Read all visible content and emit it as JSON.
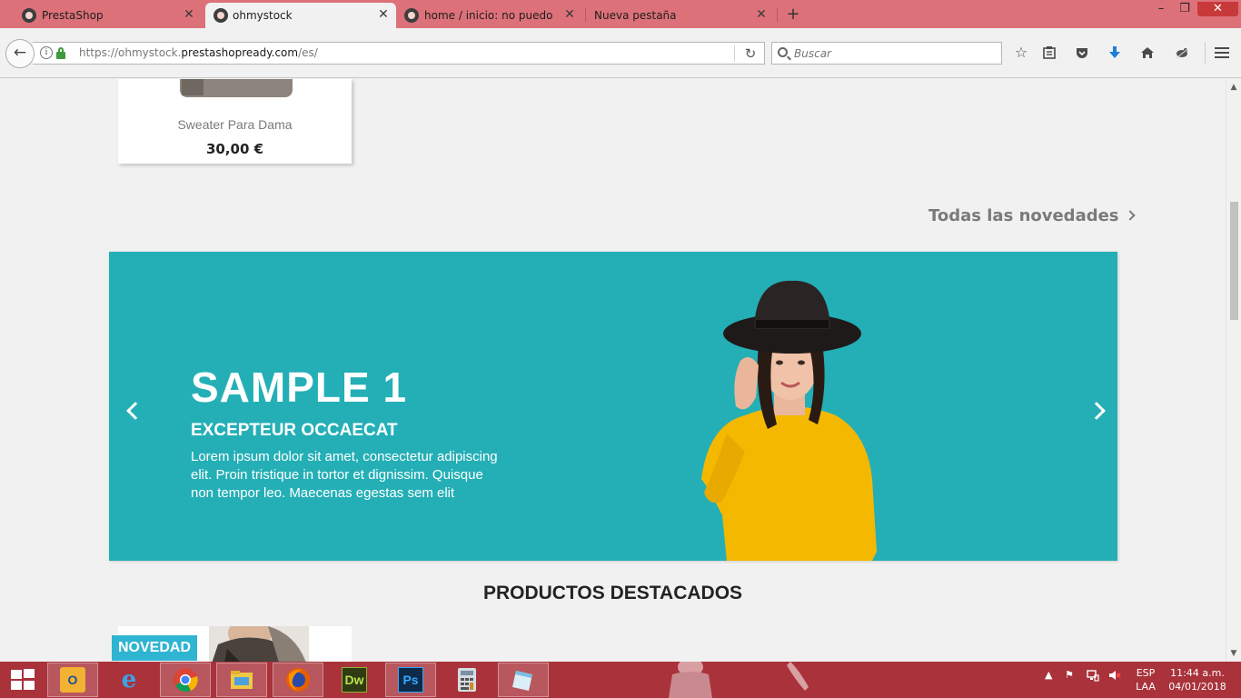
{
  "browser": {
    "tabs": [
      {
        "title": "PrestaShop",
        "active": false
      },
      {
        "title": "ohmystock",
        "active": true
      },
      {
        "title": "home / inicio: no puedo e...",
        "active": false
      },
      {
        "title": "Nueva pestaña",
        "active": false
      }
    ],
    "url_prefix": "https://ohmystock.",
    "url_domain": "prestashopready.com",
    "url_path": "/es/",
    "search_placeholder": "Buscar",
    "icons": {
      "back": "back-arrow-icon",
      "reload": "reload-icon",
      "bookmark": "star-icon",
      "reading_list": "clipboard-icon",
      "pocket": "pocket-icon",
      "downloads": "download-arrow-icon",
      "home": "home-icon",
      "extension": "extension-icon",
      "menu": "hamburger-menu-icon"
    }
  },
  "page": {
    "product": {
      "name": "Sweater Para Dama",
      "price": "30,00 €"
    },
    "all_new_link": "Todas las novedades",
    "slider": {
      "title": "SAMPLE 1",
      "subtitle": "EXCEPTEUR OCCAECAT",
      "text": "Lorem ipsum dolor sit amet, consectetur adipiscing elit. Proin tristique in tortor et dignissim. Quisque non tempor leo. Maecenas egestas sem elit",
      "background": "#24afb6"
    },
    "featured_title": "PRODUCTOS DESTACADOS",
    "badge": "NOVEDAD",
    "badge_color": "#2fb5d2"
  },
  "taskbar": {
    "color": "#a9323b",
    "apps": [
      "outlook",
      "internet-explorer",
      "chrome",
      "file-explorer",
      "firefox",
      "dreamweaver",
      "photoshop",
      "calculator",
      "notes"
    ],
    "dw_label": "Dw",
    "ps_label": "Ps",
    "lang_line1": "ESP",
    "lang_line2": "LAA",
    "time": "11:44 a.m.",
    "date": "04/01/2018"
  }
}
